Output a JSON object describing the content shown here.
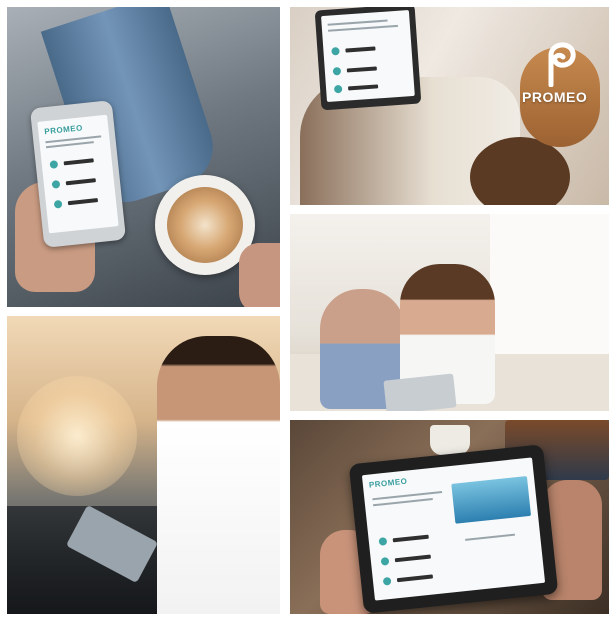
{
  "collage": {
    "brand_name": "PROMEO",
    "tiles": [
      {
        "id": "woman-phone-coffee"
      },
      {
        "id": "woman-tablet-cat"
      },
      {
        "id": "couple-sofa-tablet"
      },
      {
        "id": "man-balcony-tablet"
      },
      {
        "id": "hands-tablet-table"
      }
    ]
  },
  "colors": {
    "brand_teal": "#3ea5a5",
    "white": "#ffffff"
  }
}
